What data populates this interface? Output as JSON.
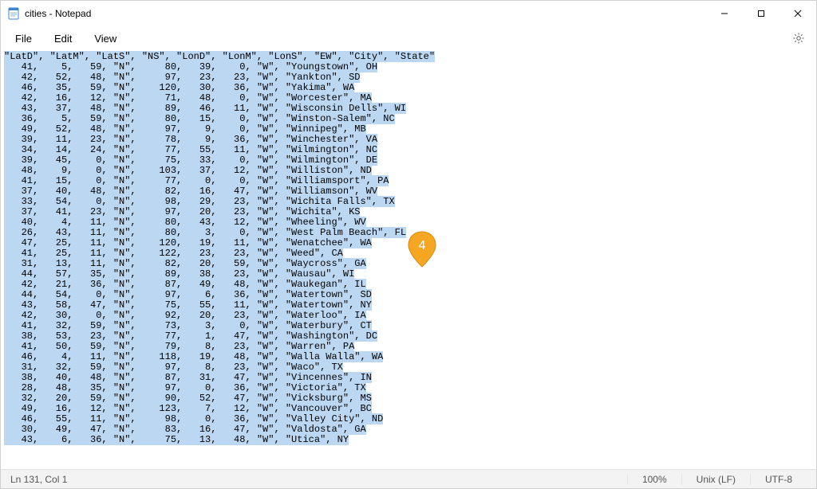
{
  "title": "cities - Notepad",
  "menu": {
    "file": "File",
    "edit": "Edit",
    "view": "View"
  },
  "status": {
    "position": "Ln 131, Col 1",
    "zoom": "100%",
    "line_ending": "Unix (LF)",
    "encoding": "UTF-8"
  },
  "pin_label": "4",
  "content_lines": [
    "\"LatD\", \"LatM\", \"LatS\", \"NS\", \"LonD\", \"LonM\", \"LonS\", \"EW\", \"City\", \"State\"",
    "   41,    5,   59, \"N\",     80,   39,    0, \"W\", \"Youngstown\", OH",
    "   42,   52,   48, \"N\",     97,   23,   23, \"W\", \"Yankton\", SD",
    "   46,   35,   59, \"N\",    120,   30,   36, \"W\", \"Yakima\", WA",
    "   42,   16,   12, \"N\",     71,   48,    0, \"W\", \"Worcester\", MA",
    "   43,   37,   48, \"N\",     89,   46,   11, \"W\", \"Wisconsin Dells\", WI",
    "   36,    5,   59, \"N\",     80,   15,    0, \"W\", \"Winston-Salem\", NC",
    "   49,   52,   48, \"N\",     97,    9,    0, \"W\", \"Winnipeg\", MB",
    "   39,   11,   23, \"N\",     78,    9,   36, \"W\", \"Winchester\", VA",
    "   34,   14,   24, \"N\",     77,   55,   11, \"W\", \"Wilmington\", NC",
    "   39,   45,    0, \"N\",     75,   33,    0, \"W\", \"Wilmington\", DE",
    "   48,    9,    0, \"N\",    103,   37,   12, \"W\", \"Williston\", ND",
    "   41,   15,    0, \"N\",     77,    0,    0, \"W\", \"Williamsport\", PA",
    "   37,   40,   48, \"N\",     82,   16,   47, \"W\", \"Williamson\", WV",
    "   33,   54,    0, \"N\",     98,   29,   23, \"W\", \"Wichita Falls\", TX",
    "   37,   41,   23, \"N\",     97,   20,   23, \"W\", \"Wichita\", KS",
    "   40,    4,   11, \"N\",     80,   43,   12, \"W\", \"Wheeling\", WV",
    "   26,   43,   11, \"N\",     80,    3,    0, \"W\", \"West Palm Beach\", FL",
    "   47,   25,   11, \"N\",    120,   19,   11, \"W\", \"Wenatchee\", WA",
    "   41,   25,   11, \"N\",    122,   23,   23, \"W\", \"Weed\", CA",
    "   31,   13,   11, \"N\",     82,   20,   59, \"W\", \"Waycross\", GA",
    "   44,   57,   35, \"N\",     89,   38,   23, \"W\", \"Wausau\", WI",
    "   42,   21,   36, \"N\",     87,   49,   48, \"W\", \"Waukegan\", IL",
    "   44,   54,    0, \"N\",     97,    6,   36, \"W\", \"Watertown\", SD",
    "   43,   58,   47, \"N\",     75,   55,   11, \"W\", \"Watertown\", NY",
    "   42,   30,    0, \"N\",     92,   20,   23, \"W\", \"Waterloo\", IA",
    "   41,   32,   59, \"N\",     73,    3,    0, \"W\", \"Waterbury\", CT",
    "   38,   53,   23, \"N\",     77,    1,   47, \"W\", \"Washington\", DC",
    "   41,   50,   59, \"N\",     79,    8,   23, \"W\", \"Warren\", PA",
    "   46,    4,   11, \"N\",    118,   19,   48, \"W\", \"Walla Walla\", WA",
    "   31,   32,   59, \"N\",     97,    8,   23, \"W\", \"Waco\", TX",
    "   38,   40,   48, \"N\",     87,   31,   47, \"W\", \"Vincennes\", IN",
    "   28,   48,   35, \"N\",     97,    0,   36, \"W\", \"Victoria\", TX",
    "   32,   20,   59, \"N\",     90,   52,   47, \"W\", \"Vicksburg\", MS",
    "   49,   16,   12, \"N\",    123,    7,   12, \"W\", \"Vancouver\", BC",
    "   46,   55,   11, \"N\",     98,    0,   36, \"W\", \"Valley City\", ND",
    "   30,   49,   47, \"N\",     83,   16,   47, \"W\", \"Valdosta\", GA",
    "   43,    6,   36, \"N\",     75,   13,   48, \"W\", \"Utica\", NY"
  ],
  "chart_data": {
    "type": "table",
    "columns": [
      "LatD",
      "LatM",
      "LatS",
      "NS",
      "LonD",
      "LonM",
      "LonS",
      "EW",
      "City",
      "State"
    ],
    "rows": [
      [
        41,
        5,
        59,
        "N",
        80,
        39,
        0,
        "W",
        "Youngstown",
        "OH"
      ],
      [
        42,
        52,
        48,
        "N",
        97,
        23,
        23,
        "W",
        "Yankton",
        "SD"
      ],
      [
        46,
        35,
        59,
        "N",
        120,
        30,
        36,
        "W",
        "Yakima",
        "WA"
      ],
      [
        42,
        16,
        12,
        "N",
        71,
        48,
        0,
        "W",
        "Worcester",
        "MA"
      ],
      [
        43,
        37,
        48,
        "N",
        89,
        46,
        11,
        "W",
        "Wisconsin Dells",
        "WI"
      ],
      [
        36,
        5,
        59,
        "N",
        80,
        15,
        0,
        "W",
        "Winston-Salem",
        "NC"
      ],
      [
        49,
        52,
        48,
        "N",
        97,
        9,
        0,
        "W",
        "Winnipeg",
        "MB"
      ],
      [
        39,
        11,
        23,
        "N",
        78,
        9,
        36,
        "W",
        "Winchester",
        "VA"
      ],
      [
        34,
        14,
        24,
        "N",
        77,
        55,
        11,
        "W",
        "Wilmington",
        "NC"
      ],
      [
        39,
        45,
        0,
        "N",
        75,
        33,
        0,
        "W",
        "Wilmington",
        "DE"
      ],
      [
        48,
        9,
        0,
        "N",
        103,
        37,
        12,
        "W",
        "Williston",
        "ND"
      ],
      [
        41,
        15,
        0,
        "N",
        77,
        0,
        0,
        "W",
        "Williamsport",
        "PA"
      ],
      [
        37,
        40,
        48,
        "N",
        82,
        16,
        47,
        "W",
        "Williamson",
        "WV"
      ],
      [
        33,
        54,
        0,
        "N",
        98,
        29,
        23,
        "W",
        "Wichita Falls",
        "TX"
      ],
      [
        37,
        41,
        23,
        "N",
        97,
        20,
        23,
        "W",
        "Wichita",
        "KS"
      ],
      [
        40,
        4,
        11,
        "N",
        80,
        43,
        12,
        "W",
        "Wheeling",
        "WV"
      ],
      [
        26,
        43,
        11,
        "N",
        80,
        3,
        0,
        "W",
        "West Palm Beach",
        "FL"
      ],
      [
        47,
        25,
        11,
        "N",
        120,
        19,
        11,
        "W",
        "Wenatchee",
        "WA"
      ],
      [
        41,
        25,
        11,
        "N",
        122,
        23,
        23,
        "W",
        "Weed",
        "CA"
      ],
      [
        31,
        13,
        11,
        "N",
        82,
        20,
        59,
        "W",
        "Waycross",
        "GA"
      ],
      [
        44,
        57,
        35,
        "N",
        89,
        38,
        23,
        "W",
        "Wausau",
        "WI"
      ],
      [
        42,
        21,
        36,
        "N",
        87,
        49,
        48,
        "W",
        "Waukegan",
        "IL"
      ],
      [
        44,
        54,
        0,
        "N",
        97,
        6,
        36,
        "W",
        "Watertown",
        "SD"
      ],
      [
        43,
        58,
        47,
        "N",
        75,
        55,
        11,
        "W",
        "Watertown",
        "NY"
      ],
      [
        42,
        30,
        0,
        "N",
        92,
        20,
        23,
        "W",
        "Waterloo",
        "IA"
      ],
      [
        41,
        32,
        59,
        "N",
        73,
        3,
        0,
        "W",
        "Waterbury",
        "CT"
      ],
      [
        38,
        53,
        23,
        "N",
        77,
        1,
        47,
        "W",
        "Washington",
        "DC"
      ],
      [
        41,
        50,
        59,
        "N",
        79,
        8,
        23,
        "W",
        "Warren",
        "PA"
      ],
      [
        46,
        4,
        11,
        "N",
        118,
        19,
        48,
        "W",
        "Walla Walla",
        "WA"
      ],
      [
        31,
        32,
        59,
        "N",
        97,
        8,
        23,
        "W",
        "Waco",
        "TX"
      ],
      [
        38,
        40,
        48,
        "N",
        87,
        31,
        47,
        "W",
        "Vincennes",
        "IN"
      ],
      [
        28,
        48,
        35,
        "N",
        97,
        0,
        36,
        "W",
        "Victoria",
        "TX"
      ],
      [
        32,
        20,
        59,
        "N",
        90,
        52,
        47,
        "W",
        "Vicksburg",
        "MS"
      ],
      [
        49,
        16,
        12,
        "N",
        123,
        7,
        12,
        "W",
        "Vancouver",
        "BC"
      ],
      [
        46,
        55,
        11,
        "N",
        98,
        0,
        36,
        "W",
        "Valley City",
        "ND"
      ],
      [
        30,
        49,
        47,
        "N",
        83,
        16,
        47,
        "W",
        "Valdosta",
        "GA"
      ],
      [
        43,
        6,
        36,
        "N",
        75,
        13,
        48,
        "W",
        "Utica",
        "NY"
      ]
    ]
  }
}
